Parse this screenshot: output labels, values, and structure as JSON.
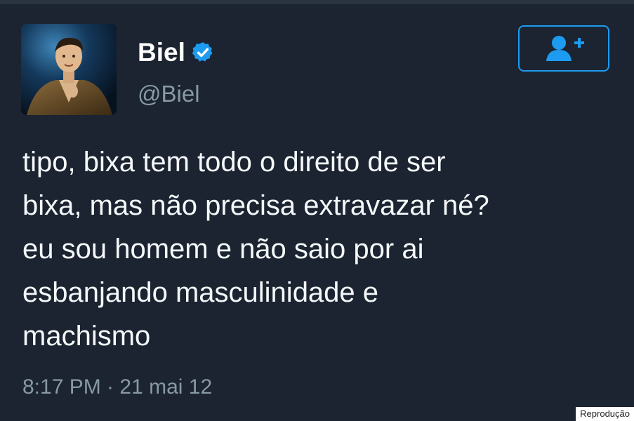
{
  "tweet": {
    "author": {
      "display_name": "Biel",
      "handle": "@Biel",
      "verified": true,
      "avatar_icon": "profile-photo"
    },
    "follow_button": {
      "icon": "add-user-icon"
    },
    "text_lines": [
      "tipo, bixa tem todo o direito de ser",
      "bixa, mas não precisa extravazar né?",
      "eu sou homem e não saio por ai",
      "esbanjando masculinidade e",
      "machismo"
    ],
    "timestamp": "8:17 PM · 21 mai 12"
  },
  "credit": "Reprodução",
  "colors": {
    "background": "#1b2430",
    "text": "#f5f8fa",
    "muted": "#8899a6",
    "accent": "#1d9bf0"
  }
}
